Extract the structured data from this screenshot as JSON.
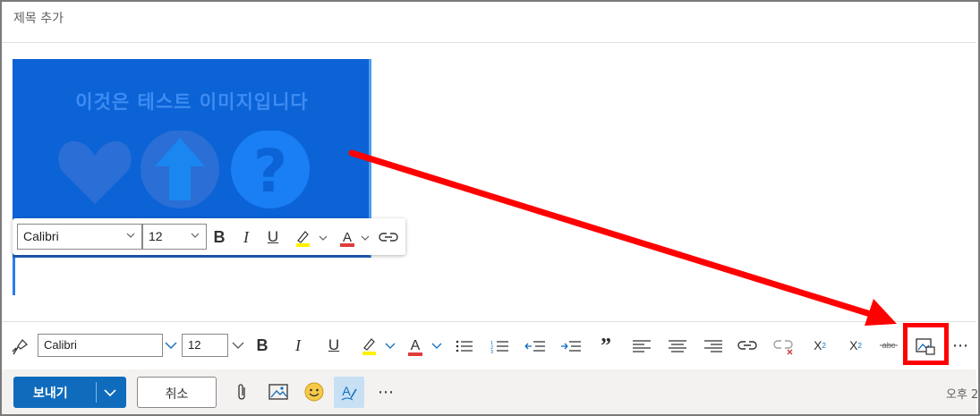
{
  "subject": {
    "placeholder": "제목 추가"
  },
  "image": {
    "caption": "이것은 테스트 이미지입니다",
    "icons": [
      "heart-icon",
      "up-arrow-icon",
      "question-icon"
    ]
  },
  "mini_toolbar": {
    "font": "Calibri",
    "size": "12"
  },
  "toolbar": {
    "font": "Calibri",
    "size": "12"
  },
  "bottom": {
    "send_label": "보내기",
    "cancel_label": "취소",
    "time_text": "오후 2"
  },
  "colors": {
    "accent": "#0f6cbd",
    "highlight": "#ff0000",
    "image_bg": "#0b63d6"
  }
}
